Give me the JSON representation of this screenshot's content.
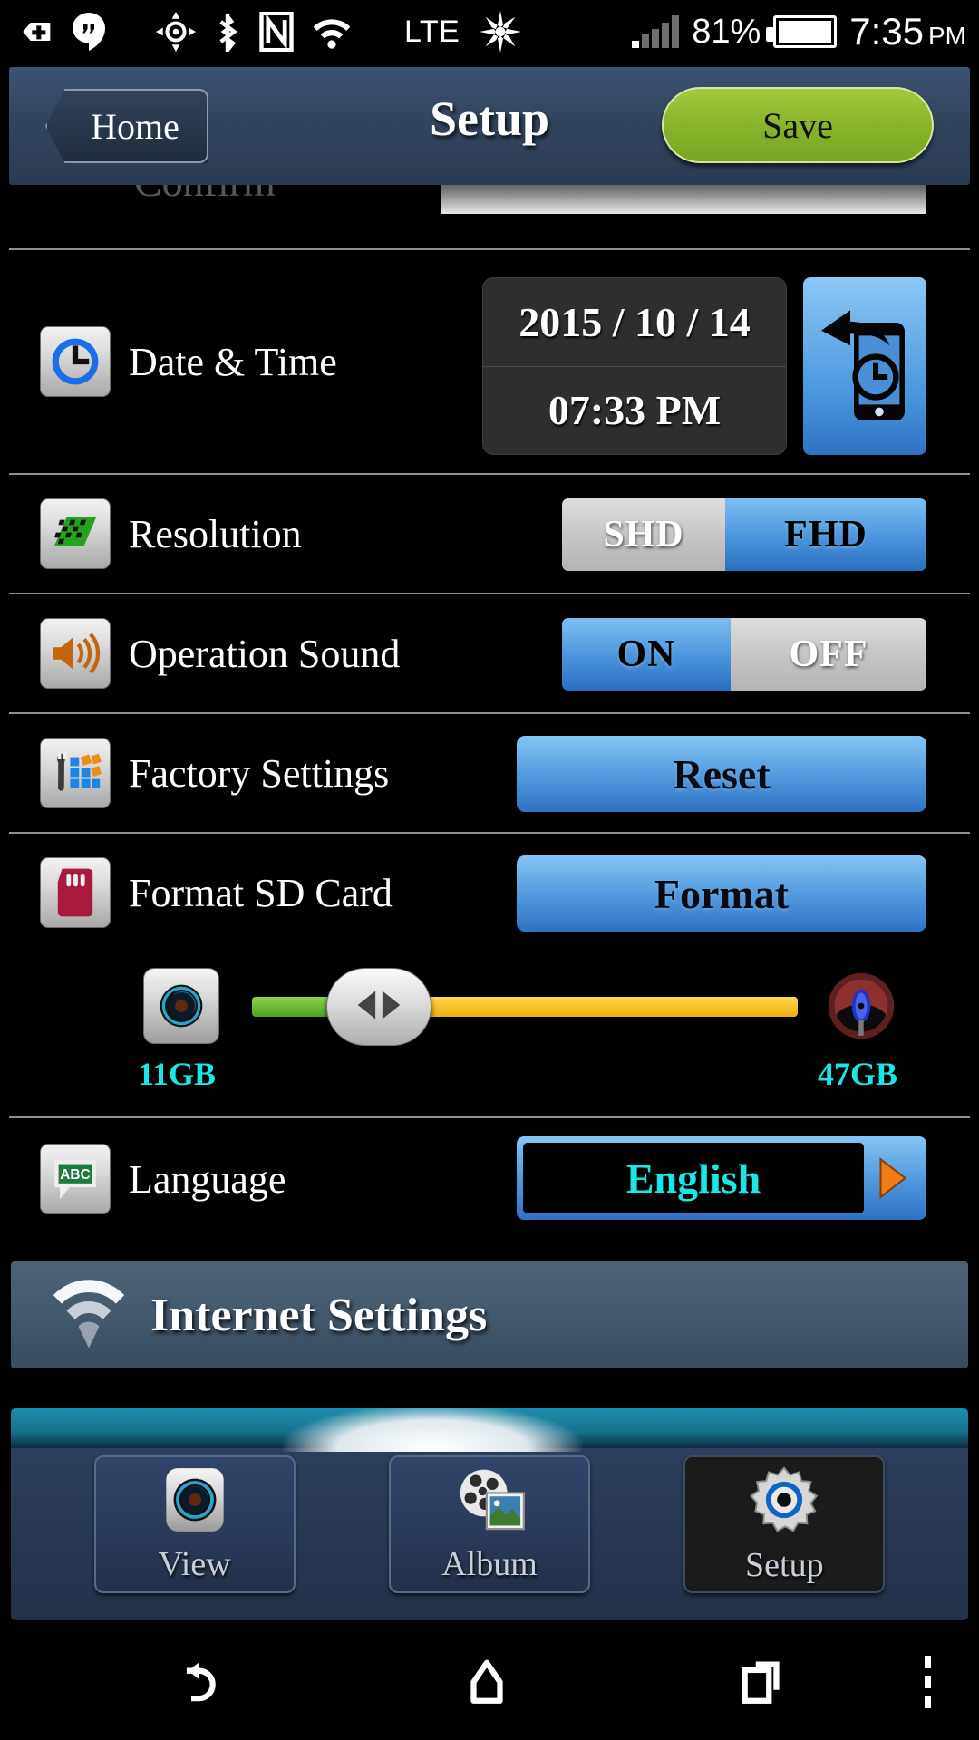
{
  "status_bar": {
    "icons": [
      "vpn-key-icon",
      "hangouts-icon",
      "location-icon",
      "bluetooth-icon",
      "nfc-icon",
      "wifi-icon",
      "brightness-icon"
    ],
    "network_type": "LTE",
    "battery_percent": "81%",
    "clock_time": "7:35",
    "clock_ampm": "PM"
  },
  "header": {
    "back_label": "Home",
    "title": "Setup",
    "save_label": "Save"
  },
  "clipped_row": {
    "label": "Confirm"
  },
  "rows": {
    "date_time": {
      "label": "Date & Time",
      "date_value": "2015 / 10 / 14",
      "time_value": "07:33 PM",
      "sync_icon": "sync-phone-clock-icon"
    },
    "resolution": {
      "label": "Resolution",
      "options": [
        "SHD",
        "FHD"
      ],
      "selected": "FHD"
    },
    "operation_sound": {
      "label": "Operation Sound",
      "options": [
        "ON",
        "OFF"
      ],
      "selected": "ON"
    },
    "factory_settings": {
      "label": "Factory Settings",
      "button_label": "Reset"
    },
    "format_sd_card": {
      "label": "Format SD Card",
      "button_label": "Format"
    },
    "storage_slider": {
      "left_icon": "camera-lens-icon",
      "right_icon": "steering-wheel-icon",
      "left_capacity": "11GB",
      "right_capacity": "47GB",
      "handle_icon": "left-right-arrows-icon",
      "green_portion_percent": 18,
      "yellow_portion_percent": 82
    },
    "language": {
      "label": "Language",
      "value": "English",
      "arrow_icon": "play-arrow-icon"
    }
  },
  "banner": {
    "label": "Internet Settings",
    "icon": "wifi-icon"
  },
  "dock": {
    "tabs": [
      {
        "label": "View",
        "icon": "camera-lens-icon",
        "active": false
      },
      {
        "label": "Album",
        "icon": "film-photo-icon",
        "active": false
      },
      {
        "label": "Setup",
        "icon": "gear-icon",
        "active": true
      }
    ]
  },
  "nav_bar": {
    "back": "back-icon",
    "home": "home-icon",
    "recents": "recents-icon",
    "more": "overflow-menu-icon"
  },
  "colors": {
    "accent_blue": "#4f96dc",
    "save_green": "#87b22a",
    "cyan_value": "#19e6e6",
    "header_navy": "#33455e"
  }
}
